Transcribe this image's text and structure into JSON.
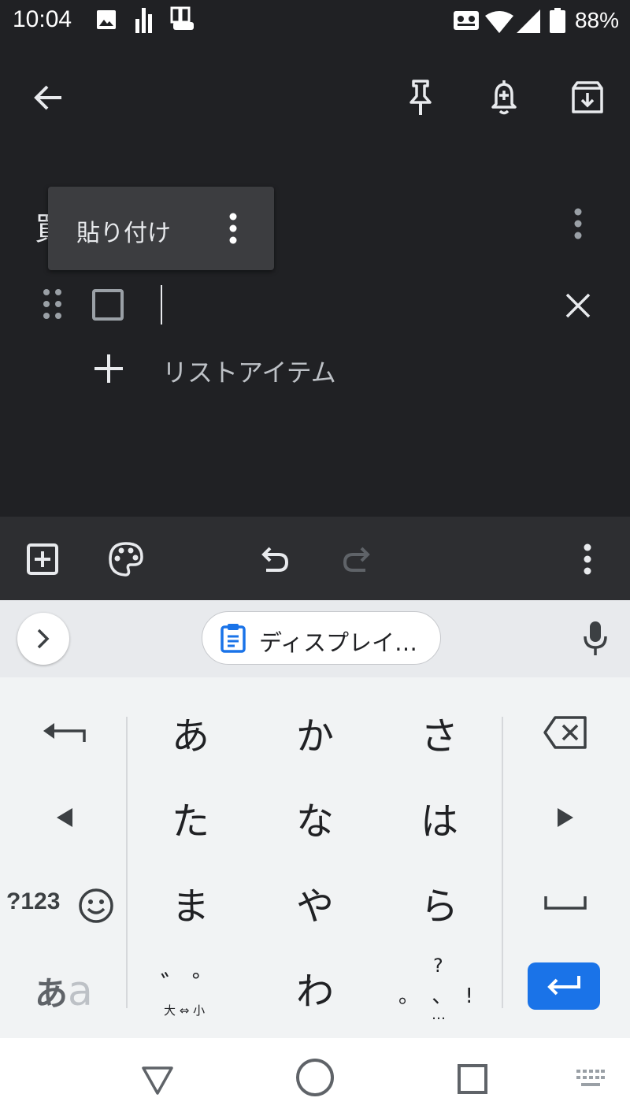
{
  "status_bar": {
    "time": "10:04",
    "battery_percent": "88%",
    "icons": [
      "image-icon",
      "chart-icon",
      "cleaning-icon",
      "voicemail-icon",
      "wifi-icon",
      "signal-icon",
      "battery-icon"
    ]
  },
  "note_toolbar": {
    "icons": [
      "back-arrow-icon",
      "pin-icon",
      "add-reminder-icon",
      "archive-icon"
    ]
  },
  "note": {
    "title_visible_fragment": "買",
    "context_menu": {
      "paste_label": "貼り付け"
    },
    "add_list_item_label": "リストアイテム"
  },
  "editor_toolbar": {
    "icons": [
      "add-box-icon",
      "palette-icon",
      "undo-icon",
      "redo-icon",
      "more-vert-icon"
    ]
  },
  "keyboard": {
    "suggestion_chip": "ディスプレイ…",
    "rows": [
      [
        "あ",
        "か",
        "さ"
      ],
      [
        "た",
        "な",
        "は"
      ],
      [
        "ま",
        "や",
        "ら"
      ],
      [
        "゛゜",
        "わ",
        "、。?!"
      ]
    ],
    "dakuten_sub": "大 ⇔ 小",
    "symbols_key": "?123",
    "mode_key_main": "あ",
    "mode_key_alt": "a",
    "punct_main": "?",
    "punct_marks": "。 、 !",
    "punct_more": "…",
    "accent_color": "#1a73e8"
  },
  "nav_bar": {
    "icons": [
      "back-triangle-icon",
      "home-circle-icon",
      "recents-square-icon",
      "keyboard-switch-icon"
    ]
  }
}
